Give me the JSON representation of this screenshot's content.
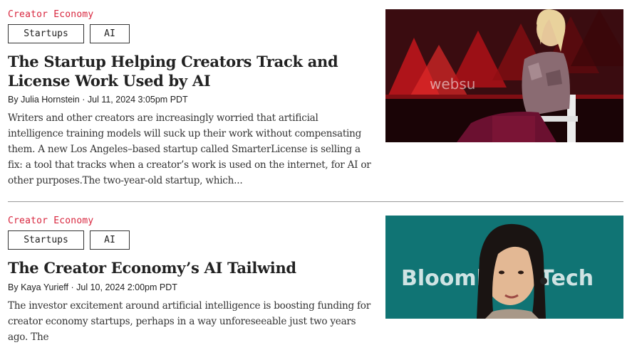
{
  "articles": [
    {
      "category": "Creator Economy",
      "tags": [
        "Startups",
        "AI"
      ],
      "headline": "The Startup Helping Creators Track and License Work Used by AI",
      "byline_prefix": "By",
      "author": "Julia Hornstein",
      "date": "Jul 11, 2024 3:05pm PDT",
      "excerpt": "Writers and other creators are increasingly worried that artificial intelligence training models will suck up their work without compensating them. A new Los Angeles–based startup called SmarterLicense is selling a fix: a tool that tracks when a creator’s work is used on the internet, for AI or other purposes.The two-year-old startup, which...",
      "image_text": "websu",
      "image_colors": {
        "background": "#2a0a0c",
        "accent": "#c4161c"
      }
    },
    {
      "category": "Creator Economy",
      "tags": [
        "Startups",
        "AI"
      ],
      "headline": "The Creator Economy’s AI Tailwind",
      "byline_prefix": "By",
      "author": "Kaya Yurieff",
      "date": "Jul 10, 2024 2:00pm PDT",
      "excerpt": "The investor excitement around artificial intelligence is boosting funding for creator economy startups, perhaps in a way unforeseeable just two years ago. The",
      "image_text": "Bloomberg Tech",
      "image_colors": {
        "background": "#0e6e6e",
        "accent": "#ffffff"
      }
    }
  ]
}
